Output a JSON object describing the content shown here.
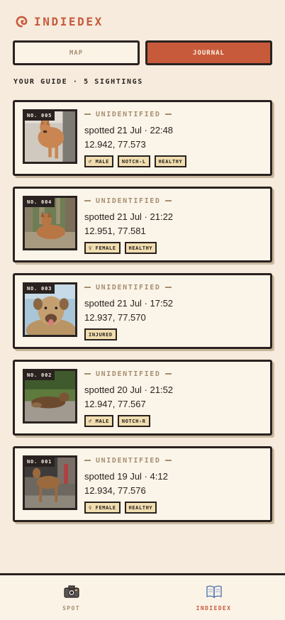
{
  "app": {
    "title": "INDIEDEX"
  },
  "tabs": {
    "map": "MAP",
    "journal": "JOURNAL"
  },
  "subheading": "YOUR GUIDE · 5 SIGHTINGS",
  "sightings": [
    {
      "no": "NO. 005",
      "status": "UNIDENTIFIED",
      "spotted": "spotted 21 Jul · 22:48",
      "coords": "12.942, 77.573",
      "tags": [
        "♂ MALE",
        "NOTCH-L",
        "HEALTHY"
      ]
    },
    {
      "no": "NO. 004",
      "status": "UNIDENTIFIED",
      "spotted": "spotted 21 Jul · 21:22",
      "coords": "12.951, 77.581",
      "tags": [
        "♀ FEMALE",
        "HEALTHY"
      ]
    },
    {
      "no": "NO. 003",
      "status": "UNIDENTIFIED",
      "spotted": "spotted 21 Jul · 17:52",
      "coords": "12.937, 77.570",
      "tags": [
        "INJURED"
      ]
    },
    {
      "no": "NO. 002",
      "status": "UNIDENTIFIED",
      "spotted": "spotted 20 Jul · 21:52",
      "coords": "12.947, 77.567",
      "tags": [
        "♂ MALE",
        "NOTCH-R"
      ]
    },
    {
      "no": "NO. 001",
      "status": "UNIDENTIFIED",
      "spotted": "spotted 19 Jul · 4:12",
      "coords": "12.934, 77.576",
      "tags": [
        "♀ FEMALE",
        "HEALTHY"
      ]
    }
  ],
  "nav": {
    "spot": "SPOT",
    "indiedex": "INDIEDEX",
    "spot_icon": "camera-icon",
    "indiedex_icon": "book-icon"
  },
  "colors": {
    "accent": "#c85a3c",
    "ink": "#2a2220",
    "paper": "#f6ebdc",
    "muted": "#a58f72",
    "tag": "#f1deb0"
  }
}
